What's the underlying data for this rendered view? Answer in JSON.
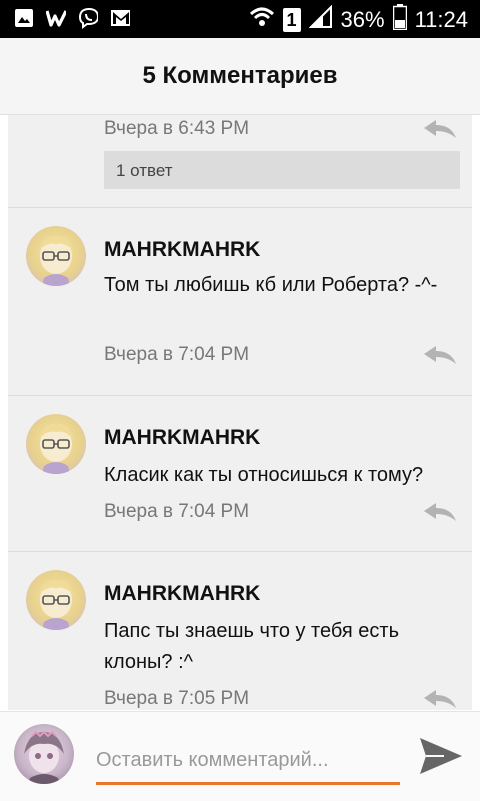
{
  "status_bar": {
    "battery": "36%",
    "time": "11:24",
    "sim": "1"
  },
  "header": {
    "title": "5 Комментариев"
  },
  "comments": [
    {
      "time": "Вчера в 6:43 PM",
      "replies_label": "1 ответ"
    },
    {
      "username": "MAHRKMAHRK",
      "text": "Том ты любишь кб или Роберта? -^-",
      "time": "Вчера в 7:04 PM"
    },
    {
      "username": "MAHRKMAHRK",
      "text": "Класик как ты относишься к тому?",
      "time": "Вчера в 7:04 PM"
    },
    {
      "username": "MAHRKMAHRK",
      "text": "Папс ты знаешь что у тебя есть клоны? :^",
      "time": "Вчера в 7:05 PM"
    }
  ],
  "composer": {
    "placeholder": "Оставить комментарий..."
  },
  "colors": {
    "accent": "#e9762b",
    "status_bar_bg": "#000000"
  }
}
